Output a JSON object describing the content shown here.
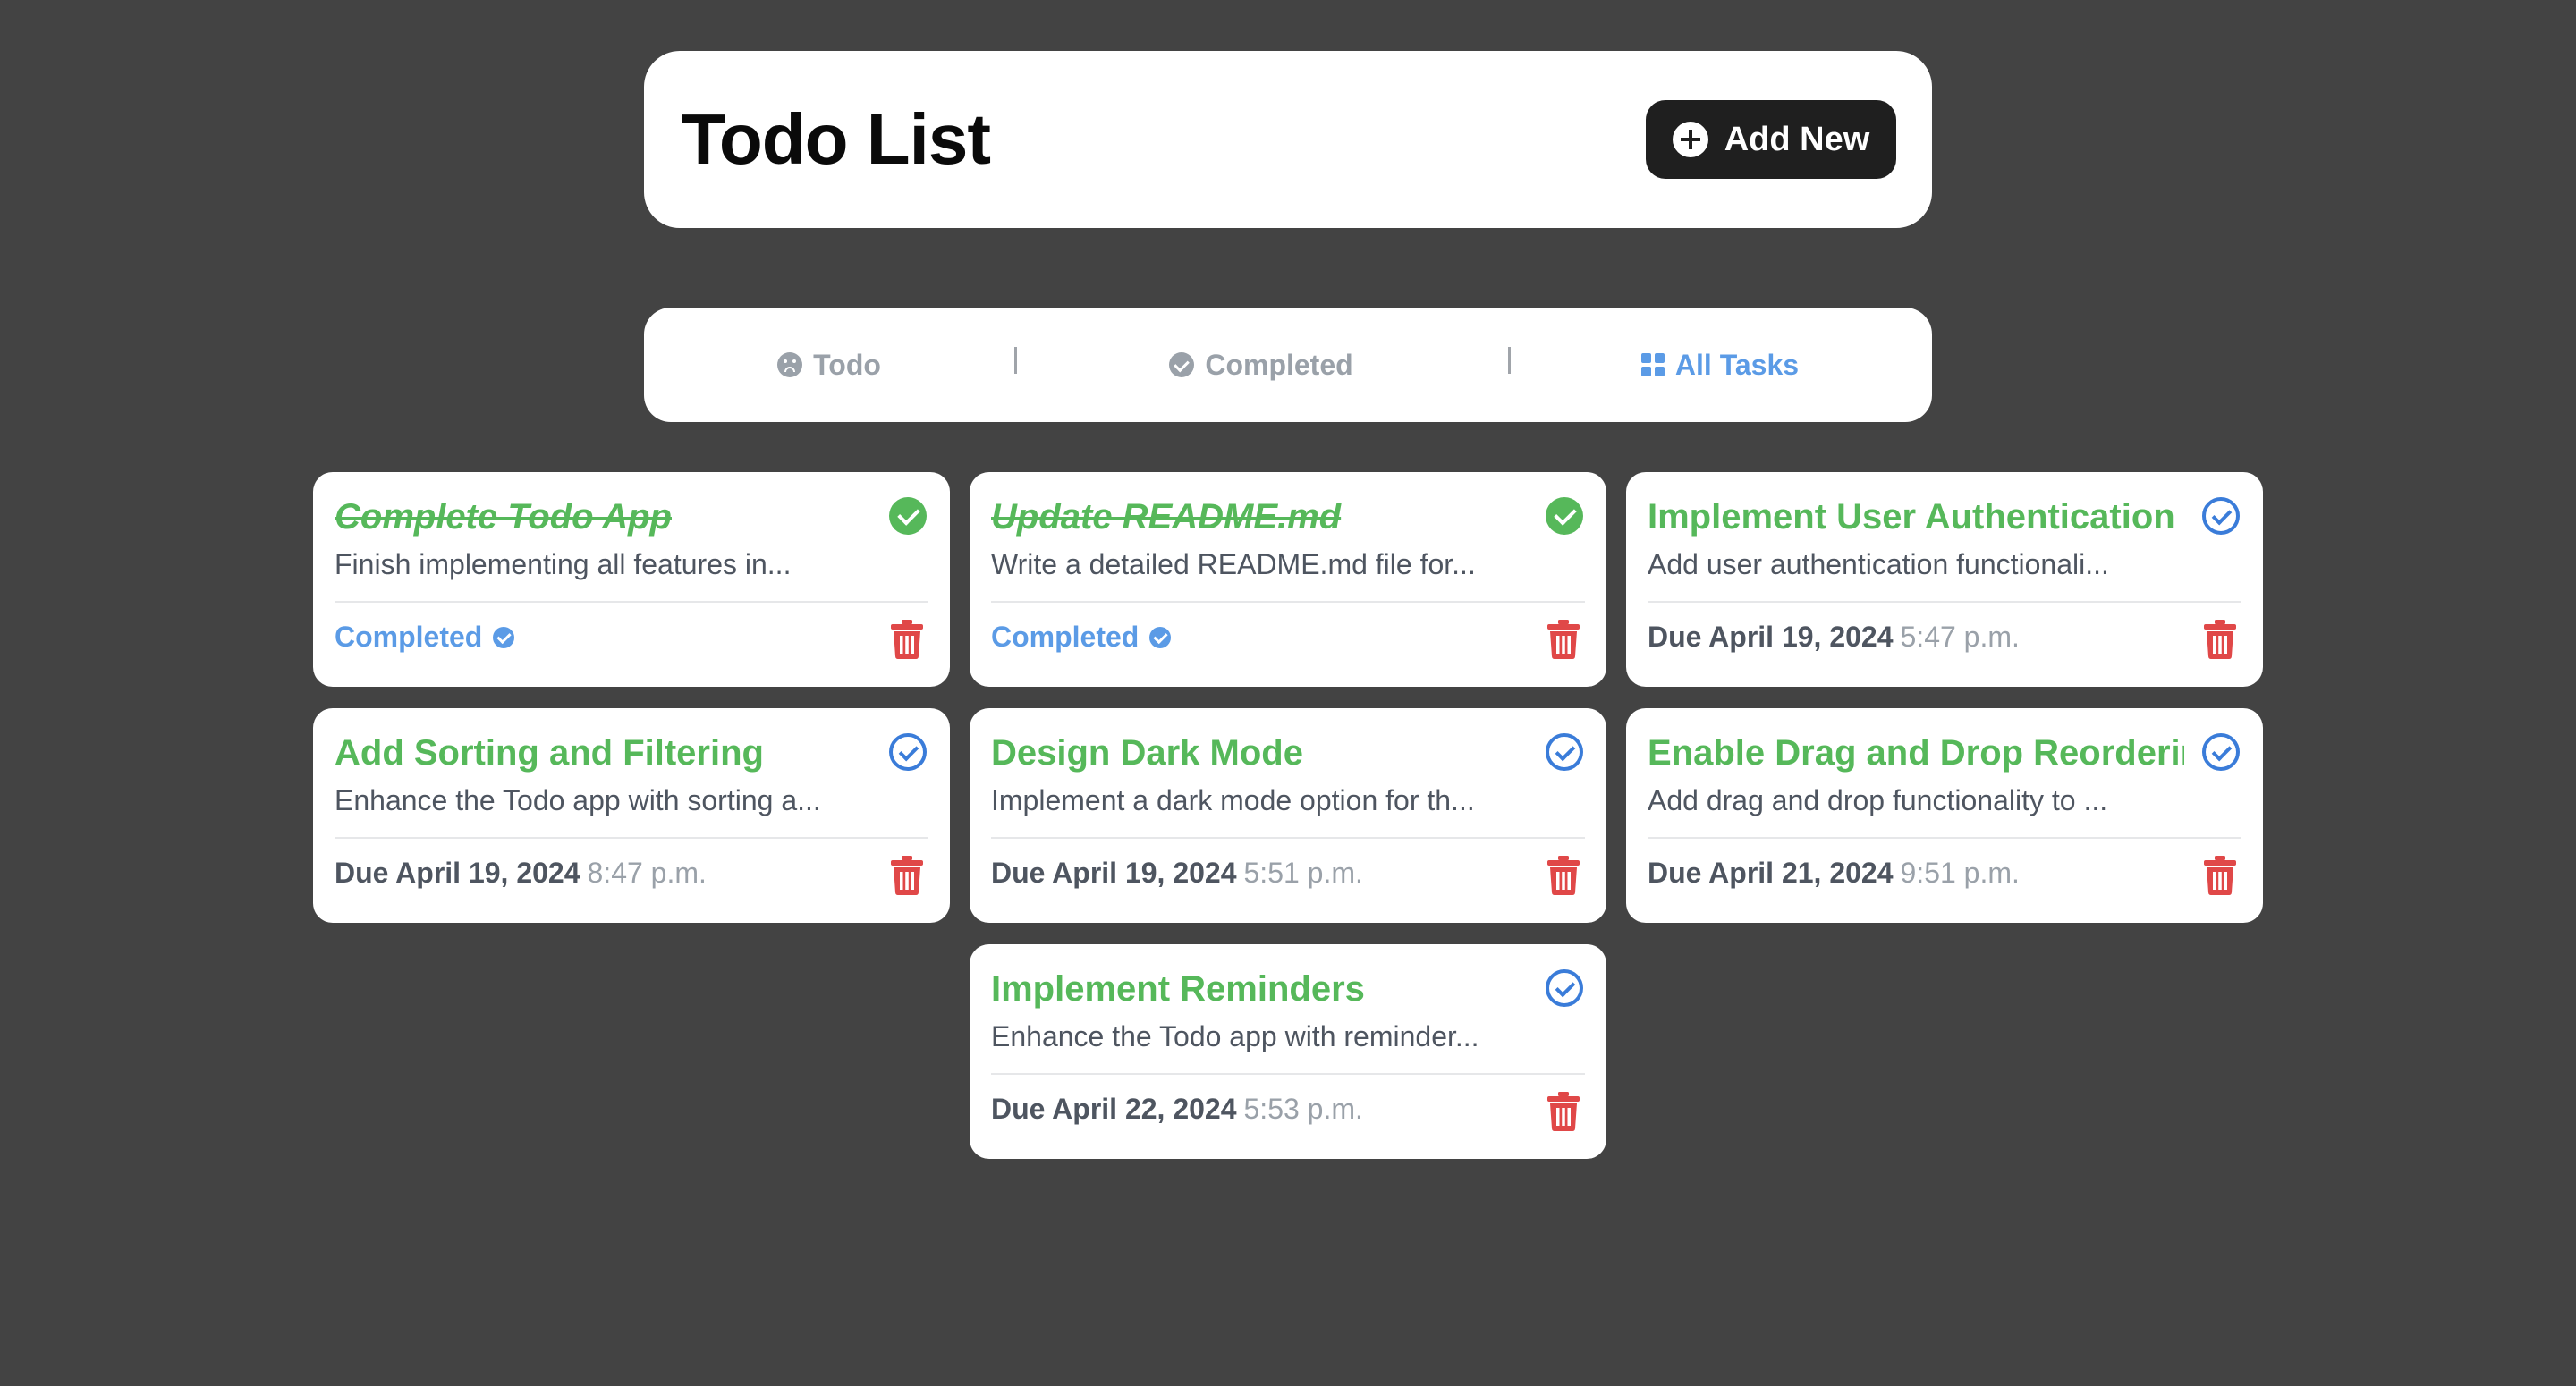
{
  "header": {
    "title": "Todo List",
    "add_button_label": "Add New"
  },
  "filters": [
    {
      "label": "Todo",
      "icon": "sad-face-icon",
      "active": false
    },
    {
      "label": "Completed",
      "icon": "badge-check-icon",
      "active": false
    },
    {
      "label": "All Tasks",
      "icon": "grid-icon",
      "active": true
    }
  ],
  "colors": {
    "background": "#434343",
    "title_green": "#56b85a",
    "accent_blue": "#5b9be6",
    "delete_red": "#e04848",
    "button_dark": "#1f1f1f"
  },
  "tasks": [
    {
      "title": "Complete Todo App",
      "description": "Finish implementing all features in...",
      "completed": true,
      "status_label": "Completed",
      "due_date": "",
      "due_time": ""
    },
    {
      "title": "Update README.md",
      "description": "Write a detailed README.md file for...",
      "completed": true,
      "status_label": "Completed",
      "due_date": "",
      "due_time": ""
    },
    {
      "title": "Implement User Authentication",
      "description": "Add user authentication functionali...",
      "completed": false,
      "status_label": "",
      "due_date": "Due April 19, 2024",
      "due_time": "5:47 p.m."
    },
    {
      "title": "Add Sorting and Filtering",
      "description": "Enhance the Todo app with sorting a...",
      "completed": false,
      "status_label": "",
      "due_date": "Due April 19, 2024",
      "due_time": "8:47 p.m."
    },
    {
      "title": "Design Dark Mode",
      "description": "Implement a dark mode option for th...",
      "completed": false,
      "status_label": "",
      "due_date": "Due April 19, 2024",
      "due_time": "5:51 p.m."
    },
    {
      "title": "Enable Drag and Drop Reorderin",
      "description": "Add drag and drop functionality to ...",
      "completed": false,
      "status_label": "",
      "due_date": "Due April 21, 2024",
      "due_time": "9:51 p.m."
    },
    {
      "title": "Implement Reminders",
      "description": "Enhance the Todo app with reminder...",
      "completed": false,
      "status_label": "",
      "due_date": "Due April 22, 2024",
      "due_time": "5:53 p.m."
    }
  ]
}
